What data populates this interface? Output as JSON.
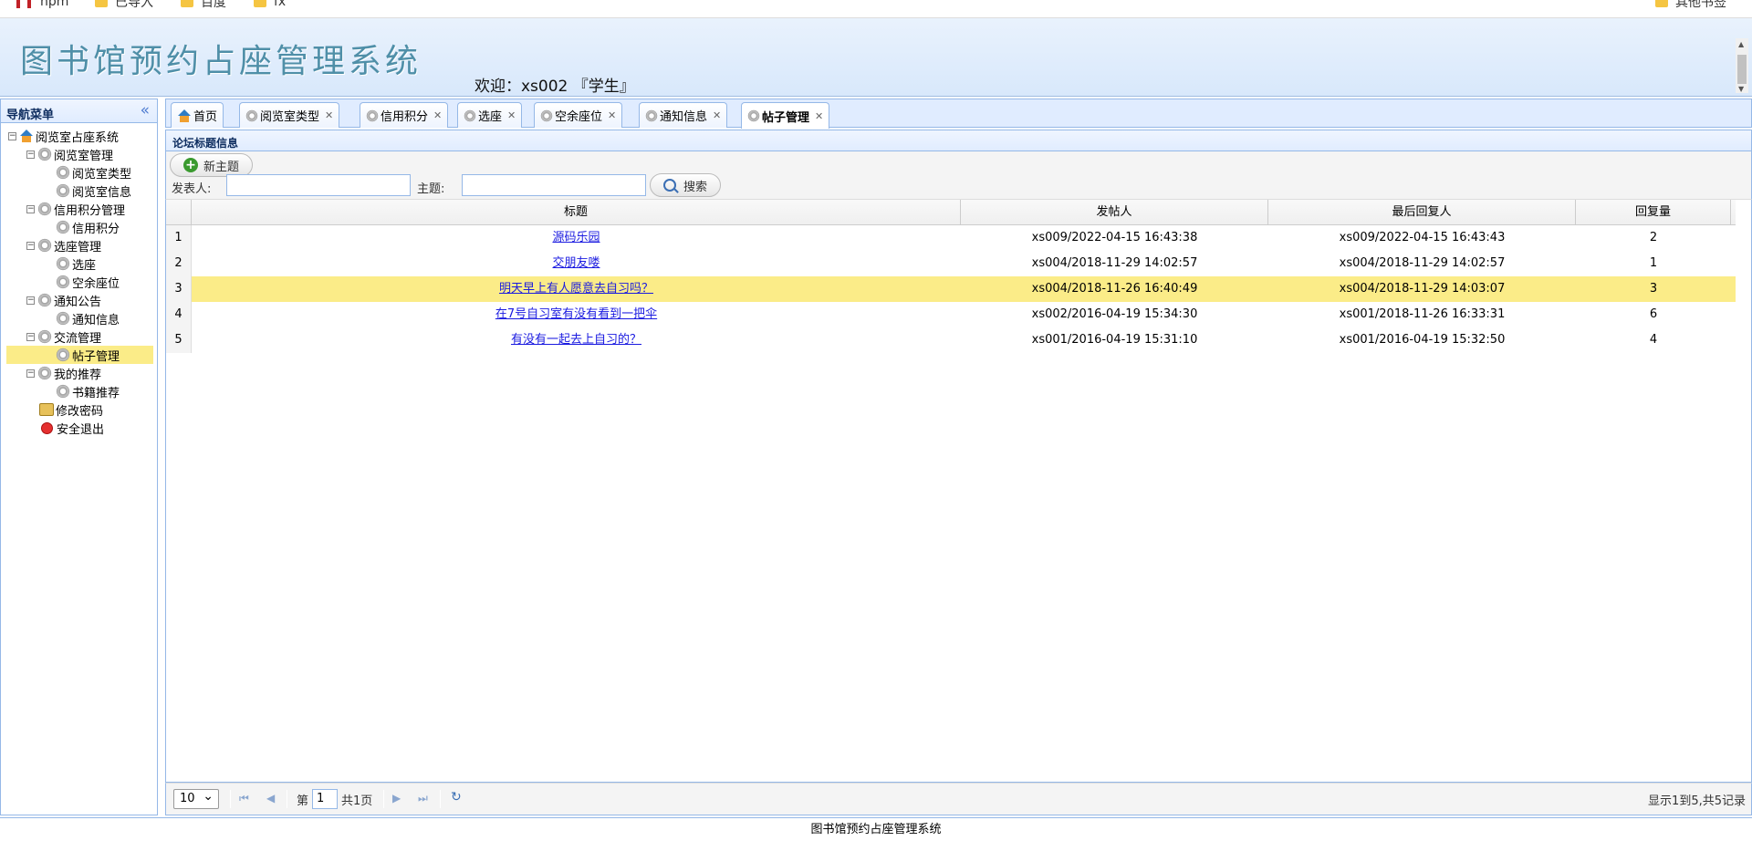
{
  "browser": {
    "bookmarks": [
      {
        "label": "npm"
      },
      {
        "label": "已导入"
      },
      {
        "label": "百度"
      },
      {
        "label": "fx"
      }
    ],
    "other_bookmarks": "其他书签"
  },
  "header": {
    "app_title": "图书馆预约占座管理系统",
    "welcome": "欢迎：xs002 『学生』"
  },
  "sidebar": {
    "title": "导航菜单",
    "collapse_icon": "double-chevron-left-icon",
    "root": "阅览室占座系统",
    "items": [
      {
        "label": "阅览室管理",
        "level": 1
      },
      {
        "label": "阅览室类型",
        "level": 2
      },
      {
        "label": "阅览室信息",
        "level": 2
      },
      {
        "label": "信用积分管理",
        "level": 1
      },
      {
        "label": "信用积分",
        "level": 2
      },
      {
        "label": "选座管理",
        "level": 1
      },
      {
        "label": "选座",
        "level": 2
      },
      {
        "label": "空余座位",
        "level": 2
      },
      {
        "label": "通知公告",
        "level": 1
      },
      {
        "label": "通知信息",
        "level": 2
      },
      {
        "label": "交流管理",
        "level": 1
      },
      {
        "label": "帖子管理",
        "level": 2,
        "selected": true
      },
      {
        "label": "我的推荐",
        "level": 1
      },
      {
        "label": "书籍推荐",
        "level": 2
      },
      {
        "label": "修改密码",
        "level": 1
      },
      {
        "label": "安全退出",
        "level": 1
      }
    ]
  },
  "tabs": [
    {
      "label": "首页",
      "closable": false
    },
    {
      "label": "阅览室类型",
      "closable": true
    },
    {
      "label": "信用积分",
      "closable": true
    },
    {
      "label": "选座",
      "closable": true
    },
    {
      "label": "空余座位",
      "closable": true
    },
    {
      "label": "通知信息",
      "closable": true
    },
    {
      "label": "帖子管理",
      "closable": true,
      "active": true
    }
  ],
  "panel": {
    "title": "论坛标题信息",
    "new_topic_button": "新主题",
    "poster_label": "发表人:",
    "poster_value": "",
    "topic_label": "主题:",
    "topic_value": "",
    "search_button": "搜索"
  },
  "grid": {
    "columns": [
      "标题",
      "发帖人",
      "最后回复人",
      "回复量"
    ],
    "rows": [
      {
        "no": "1",
        "title": "源码乐园",
        "poster": "xs009/2022-04-15 16:43:38",
        "last_reply": "xs009/2022-04-15 16:43:43",
        "replies": "2"
      },
      {
        "no": "2",
        "title": "交朋友喽",
        "poster": "xs004/2018-11-29 14:02:57",
        "last_reply": "xs004/2018-11-29 14:02:57",
        "replies": "1"
      },
      {
        "no": "3",
        "title": "明天早上有人愿意去自习吗？",
        "poster": "xs004/2018-11-26 16:40:49",
        "last_reply": "xs004/2018-11-29 14:03:07",
        "replies": "3",
        "highlight": true
      },
      {
        "no": "4",
        "title": "在7号自习室有没有看到一把伞",
        "poster": "xs002/2016-04-19 15:34:30",
        "last_reply": "xs001/2018-11-26 16:33:31",
        "replies": "6"
      },
      {
        "no": "5",
        "title": "有没有一起去上自习的？",
        "poster": "xs001/2016-04-19 15:31:10",
        "last_reply": "xs001/2016-04-19 15:32:50",
        "replies": "4"
      }
    ]
  },
  "pager": {
    "page_size": "10",
    "page_prefix": "第",
    "page_value": "1",
    "page_total": "共1页",
    "summary": "显示1到5,共5记录"
  },
  "footer": {
    "text": "图书馆预约占座管理系统"
  }
}
